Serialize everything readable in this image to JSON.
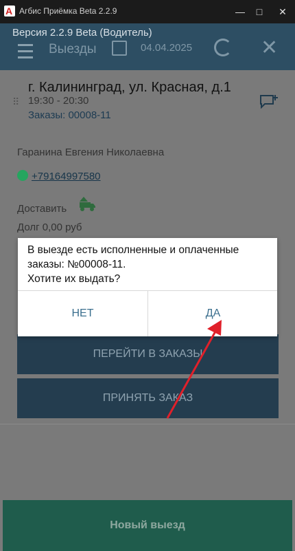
{
  "window": {
    "title": "Агбис Приёмка Beta 2.2.9",
    "app_icon_letter": "A",
    "minimize": "—",
    "maximize": "□",
    "close": "✕"
  },
  "appbar": {
    "version": "Версия 2.2.9 Beta (Водитель)",
    "section": "Выезды",
    "date": "04.04.2025",
    "close_glyph": "✕"
  },
  "trip": {
    "address": "г. Калининград, ул. Красная, д.1",
    "time": "19:30 - 20:30",
    "orders": "Заказы: 00008-11",
    "client_name": "Гаранина Евгения Николаевна",
    "phone": "+79164997580",
    "action": "Доставить",
    "debt": "Долг 0,00 руб",
    "drag_glyph": "⠿"
  },
  "buttons": {
    "goto_orders": "ПЕРЕЙТИ В ЗАКАЗЫ",
    "accept_order": "ПРИНЯТЬ ЗАКАЗ",
    "new_trip": "Новый выезд"
  },
  "dialog": {
    "message": "В выезде есть исполненные и оплаченные\nзаказы: №00008-11.\nХотите их выдать?",
    "no": "НЕТ",
    "yes": "ДА"
  },
  "colors": {
    "appbar": "#2d4e63",
    "accent_text": "#3b6f8e",
    "annotation_arrow": "#e0202a",
    "bottom_button": "#1f5c4c"
  }
}
